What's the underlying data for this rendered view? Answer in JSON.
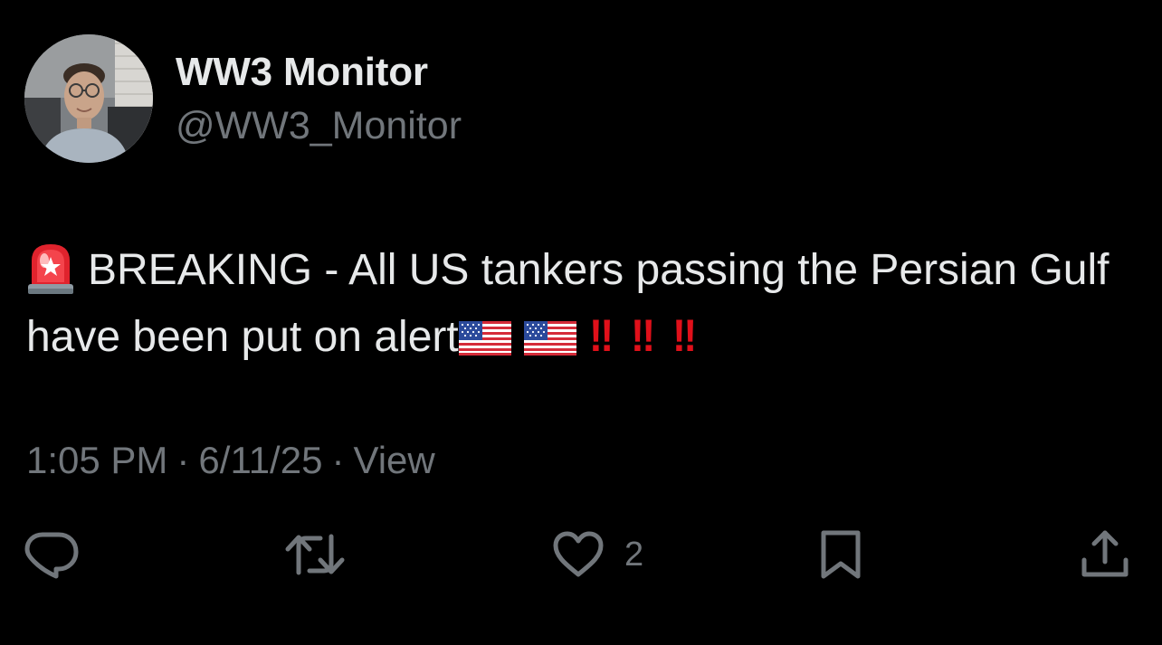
{
  "author": {
    "display_name": "WW3 Monitor",
    "handle": "@WW3_Monitor",
    "avatar_icon": "profile-photo"
  },
  "tweet": {
    "lead_emoji": "police-car-light-icon",
    "text_line": "BREAKING - All US tankers passing the Persian Gulf have been put on alert",
    "flag_emoji": "us-flag-icon",
    "double_exclamation": "‼",
    "exclamation_color": "#e0101a"
  },
  "meta": {
    "time": "1:05 PM",
    "separator": "·",
    "date": "6/11/25",
    "views_label": "View"
  },
  "actions": {
    "reply_icon": "reply-icon",
    "retweet_icon": "retweet-icon",
    "like_icon": "heart-icon",
    "like_count": "2",
    "bookmark_icon": "bookmark-icon",
    "share_icon": "share-icon"
  },
  "colors": {
    "background": "#000000",
    "primary_text": "#e7e9ea",
    "secondary_text": "#71767b"
  }
}
